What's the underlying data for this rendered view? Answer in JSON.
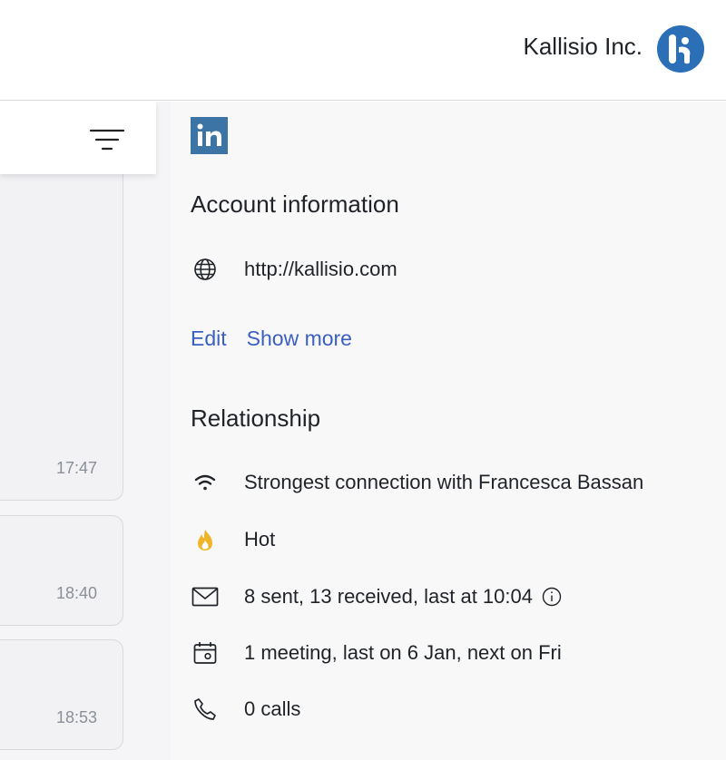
{
  "header": {
    "company_name": "Kallisio Inc.",
    "logo_color": "#2b6fb6"
  },
  "list": {
    "filter_icon": "filter-lines-icon",
    "items": [
      {
        "time": "17:47"
      },
      {
        "time": "18:40"
      },
      {
        "time": "18:53"
      }
    ]
  },
  "account": {
    "linkedin_icon": "linkedin-icon",
    "title": "Account information",
    "website": "http://kallisio.com",
    "edit_label": "Edit",
    "show_more_label": "Show more"
  },
  "relationship": {
    "title": "Relationship",
    "connection": "Strongest connection with Francesca Bassan",
    "temperature": "Hot",
    "emails": "8 sent, 13 received, last at 10:04",
    "meetings": "1 meeting, last on 6 Jan, next on Fri",
    "calls": "0 calls"
  },
  "colors": {
    "link": "#3b5fc0",
    "hot": "#f0b429",
    "linkedin": "#3d74a6"
  }
}
